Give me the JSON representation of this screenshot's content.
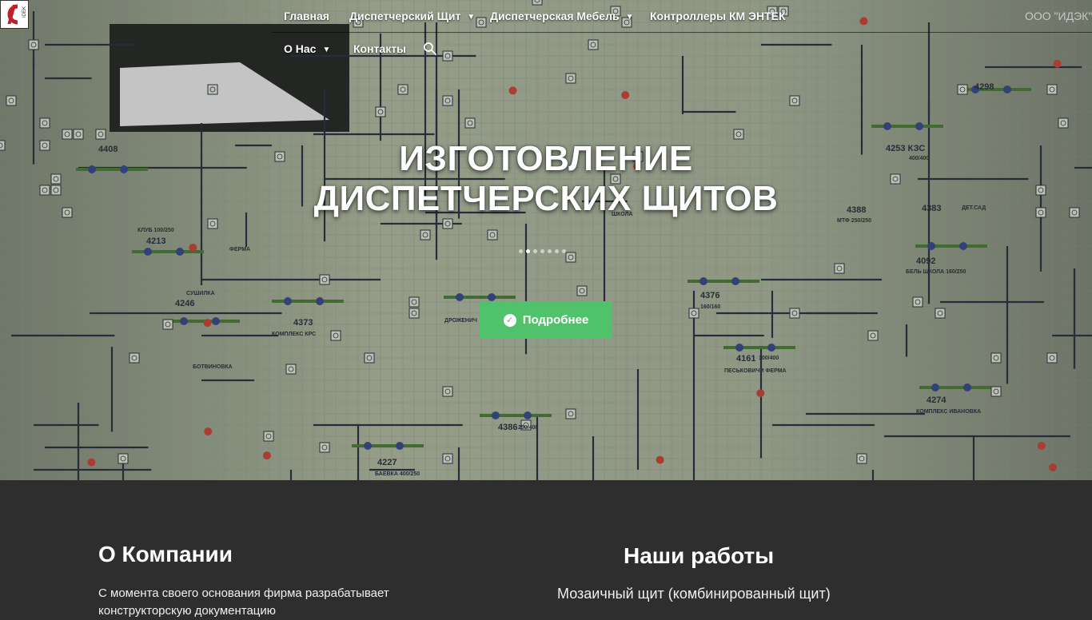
{
  "header": {
    "logo_letters": "IDEK",
    "nav": [
      {
        "label": "Главная",
        "has_dropdown": false
      },
      {
        "label": "Диспетчерский Щит",
        "has_dropdown": true
      },
      {
        "label": "Диспетчерская Мебель",
        "has_dropdown": true
      },
      {
        "label": "Контроллеры КМ ЭНТЕК",
        "has_dropdown": false
      },
      {
        "label": "О Нас",
        "has_dropdown": true
      },
      {
        "label": "Контакты",
        "has_dropdown": false
      }
    ],
    "company_name": "ООО \"ИДЭК\""
  },
  "hero": {
    "title_line1": "ИЗГОТОВЛЕНИЕ",
    "title_line2": "ДИСПЕТЧЕРСКИХ ЩИТОВ",
    "slide_count": 7,
    "active_slide": 1,
    "cta_label": "Подробнее",
    "background_labels": [
      "4408",
      "4213",
      "4246",
      "4373",
      "4386",
      "4227",
      "4376",
      "4161",
      "4274",
      "4253 КЗС",
      "4388",
      "4383",
      "4092",
      "4298",
      "ФЕРМА",
      "СУШИЛКА",
      "КЛУБ 100/250",
      "ПЕСЬКОВИЧИ ФЕРМА",
      "КОМПЛЕКС ИВАНОВКА",
      "БЕЛЬ ШКОЛА 160/250",
      "КОМПЛЕКС КРС",
      "ДРОЖЕНИЧ",
      "БАЕВКА 400/250",
      "МТФ 250/250",
      "ДЕТ.САД",
      "БОТВИНОВКА",
      "ШКОЛА",
      "400/400",
      "100/400",
      "160/160",
      "250/400"
    ]
  },
  "about": {
    "title": "О Компании",
    "text": " С момента своего основания фирма разрабатывает конструкторскую документацию"
  },
  "works": {
    "title": "Наши работы",
    "first_item": "Мозаичный щит (комбинированный щит)"
  },
  "colors": {
    "cta": "#4fc26b",
    "section_bg": "#2e2e2e",
    "panel_bg": "#9fa894",
    "line": "#2c3440"
  },
  "icons": [
    "logo-icon",
    "chevron-down-icon",
    "search-icon",
    "check-circle-icon"
  ]
}
